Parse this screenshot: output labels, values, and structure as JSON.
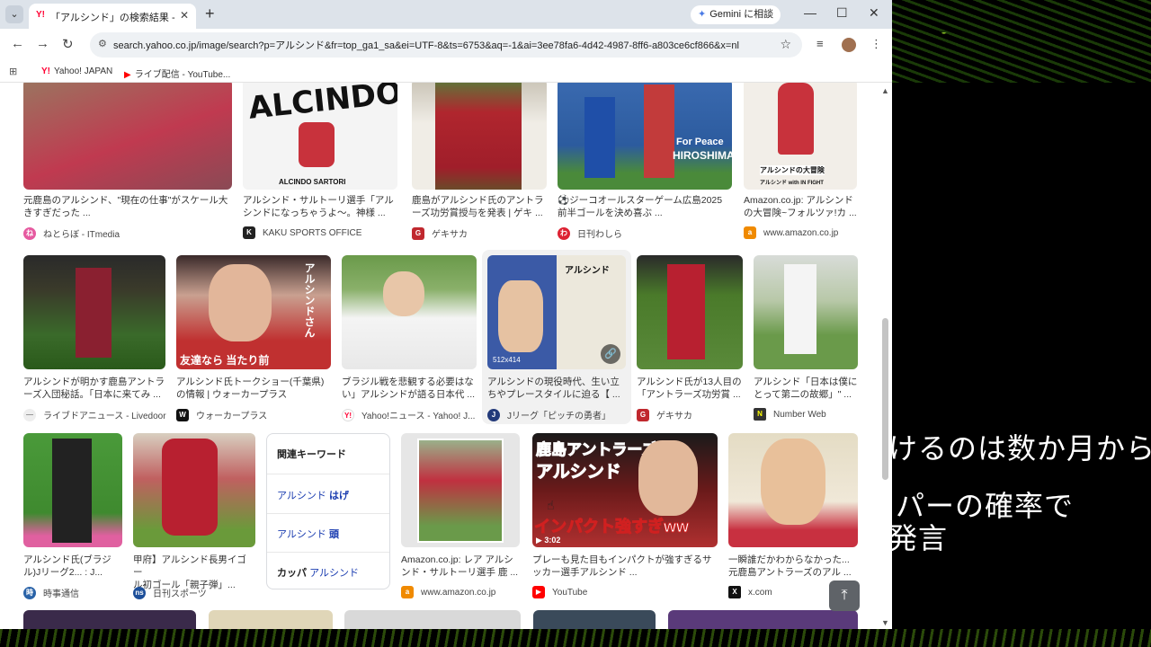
{
  "browser": {
    "tab_title": "「アルシンド」の検索結果 - Yahoo!",
    "tab_favicon": "Y!",
    "gemini_label": "Gemini に相談",
    "url": "search.yahoo.co.jp/image/search?p=アルシンド&fr=top_ga1_sa&ei=UTF-8&ts=6753&aq=-1&ai=3ee78fa6-4d42-4987-8ff6-a803ce6cf866&x=nl",
    "bookmarks": [
      {
        "label": "Yahoo! JAPAN",
        "icon": "Y!",
        "color": "#f03"
      },
      {
        "label": "ライブ配信 - YouTube...",
        "icon": "▶",
        "color": "#f00"
      }
    ]
  },
  "overlay_text": {
    "line1": "けるのは数か月から",
    "line2": "パーの確率で",
    "line3": "発言"
  },
  "results": {
    "row1": [
      {
        "caption": "元鹿島のアルシンド、\"現在の仕事\"がスケール大\nきすぎだった ...",
        "source": "ねとらぼ - ITmedia",
        "icon": "ね",
        "icon_color": "#e65aa0",
        "bg": "#b86a70"
      },
      {
        "caption": "アルシンド・サルトーリ選手「アル\nシンドになっちゃうよ〜。神様 ...",
        "source": "KAKU SPORTS OFFICE",
        "icon": "K",
        "icon_color": "#222",
        "bg": "#f4f4f4",
        "art_text": "ALCINDO",
        "art_sub": "ALCINDO SARTORI"
      },
      {
        "caption": "鹿島がアルシンド氏のアントラ\nーズ功労賞授与を発表 | ゲキ ...",
        "source": "ゲキサカ",
        "icon": "G",
        "icon_color": "#c0282e",
        "bg": "#a7262e"
      },
      {
        "caption": "⚽ジーコオールスターゲーム広島2025\n前半ゴールを決め喜ぶ ...",
        "source": "日刊わしら",
        "icon": "わ",
        "icon_color": "#d23",
        "bg": "#2c5b9e",
        "art_text": "For Peace",
        "art_sub": "HIROSHIMA"
      },
      {
        "caption": "Amazon.co.jp: アルシンド\nの大冒険~フォルツァ!カ ...",
        "source": "www.amazon.co.jp",
        "icon": "a",
        "icon_color": "#f08a00",
        "bg": "#f2eee8",
        "art_text": "アルシンドの大冒険",
        "art_sub": "アルシンド with IN FIGHT"
      }
    ],
    "row2": [
      {
        "caption": "アルシンドが明かす鹿島アントラ\nーズ入団秘話。「日本に来てみ ...",
        "source": "ライブドアニュース - Livedoor",
        "icon": "—",
        "icon_color": "#888",
        "bg": "#3a6a2a"
      },
      {
        "caption": "アルシンド氏トークショー(千葉県)\nの情報 | ウォーカープラス",
        "source": "ウォーカープラス",
        "icon": "W",
        "icon_color": "#111",
        "bg": "#b03030",
        "art_text": "友達なら 当たり前",
        "art_sub": "アルシンドさん"
      },
      {
        "caption": "ブラジル戦を悲観する必要はな\nい」アルシンドが語る日本代 ...",
        "source": "Yahoo!ニュース - Yahoo! J...",
        "icon": "Y!",
        "icon_color": "#f03",
        "bg": "#5a8a3a"
      },
      {
        "caption": "アルシンドの現役時代、生い立\nちやプレースタイルに迫る【 ...",
        "source": "Jリーグ「ピッチの勇者」",
        "icon": "J",
        "icon_color": "#233a7a",
        "bg": "#3b5aa6",
        "art_text": "アルシンド",
        "art_sub": "512x414"
      },
      {
        "caption": "アルシンド氏が13人目の\n「アントラーズ功労賞 ...",
        "source": "ゲキサカ",
        "icon": "G",
        "icon_color": "#c0282e",
        "bg": "#4a7a2a"
      },
      {
        "caption": "アルシンド「日本は僕に\nとって第二の故郷」\" ...",
        "source": "Number Web",
        "icon": "N",
        "icon_color": "#333",
        "bg": "#6a9a4a"
      }
    ],
    "row3": [
      {
        "caption": "アルシンド氏(ブラジ\nル)Jリーグ2... : J...",
        "source": "時事通信",
        "icon": "時",
        "icon_color": "#2a63a8",
        "bg": "#3f8a2f"
      },
      {
        "caption": "甲府】アルシンド長男イゴー\nル初ゴール「親子弾」...",
        "source": "日刊スポーツ",
        "icon": "ns",
        "icon_color": "#1d4f9a",
        "bg": "#b03a3a"
      },
      {
        "caption": "Amazon.co.jp: レア アルシ\nンド・サルトーリ選手 鹿 ...",
        "source": "www.amazon.co.jp",
        "icon": "a",
        "icon_color": "#f08a00",
        "bg": "#c9c9c9"
      },
      {
        "caption": "プレーも見た目もインパクトが強すぎるサ\nッカー選手アルシンド ...",
        "source": "YouTube",
        "icon": "▶",
        "icon_color": "#f00",
        "bg": "#8a1c1c",
        "art_text": "鹿島アントラーズ",
        "art_sub": "アルシンド",
        "art_bottom": "インパクト強すぎww",
        "duration": "▶ 3:02"
      },
      {
        "caption": "一瞬誰だかわからなかった...\n元鹿島アントラーズのアル ...",
        "source": "x.com",
        "icon": "X",
        "icon_color": "#111",
        "bg": "#d8c9a8"
      }
    ]
  },
  "related": {
    "heading": "関連キーワード",
    "items": [
      {
        "pre": "アルシンド ",
        "bold": "はげ"
      },
      {
        "pre": "アルシンド ",
        "bold": "頭"
      },
      {
        "pre": "カッパ ",
        "bold": "アルシンド",
        "bold_first": true
      }
    ]
  },
  "ui_icons": {
    "back": "←",
    "forward": "→",
    "reload": "↻",
    "star": "☆",
    "to_top": "⤒"
  }
}
